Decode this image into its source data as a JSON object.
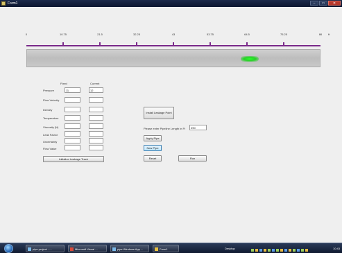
{
  "window": {
    "title": "Form1",
    "min_glyph": "–",
    "max_glyph": "□",
    "close_glyph": "✕"
  },
  "axis": {
    "ticks": [
      "0",
      "10.75",
      "21.5",
      "32.25",
      "43",
      "53.75",
      "64.5",
      "75.25",
      "86"
    ],
    "unit": "ft"
  },
  "peak": {
    "center_fraction": 0.76
  },
  "table": {
    "headers": {
      "fixed": "Fixed",
      "current": "Current"
    },
    "rows": [
      {
        "label": "Pressure",
        "fixed": "11",
        "current": "12"
      },
      {
        "label": "Flow Velocity",
        "fixed": "",
        "current": ""
      },
      {
        "label": "Density",
        "fixed": "",
        "current": ""
      },
      {
        "label": "Temperature",
        "fixed": "",
        "current": ""
      },
      {
        "label": "Viscosity (N)",
        "fixed": "",
        "current": ""
      },
      {
        "label": "Leak Factor",
        "fixed": "",
        "current": ""
      },
      {
        "label": "Uncertainty",
        "fixed": "",
        "current": ""
      },
      {
        "label": "Flow Value",
        "fixed": "",
        "current": ""
      }
    ],
    "init_button": "Initialize Leakage Track"
  },
  "controls": {
    "install_button": "Install Leakage Point",
    "pipeline_label": "Please enter Pipeline Length in Ft",
    "pipeline_value": "290",
    "apply_button": "Apply Pipe",
    "new_pipe_button": "New Pipe",
    "reset_button": "Reset",
    "run_button": "Run"
  },
  "taskbar": {
    "tasks": [
      "pipe project - ...",
      "Microsoft Visual ...",
      "pipe Windows App ...",
      "Form1"
    ],
    "lang": "Desktop",
    "clock": "10:43"
  }
}
